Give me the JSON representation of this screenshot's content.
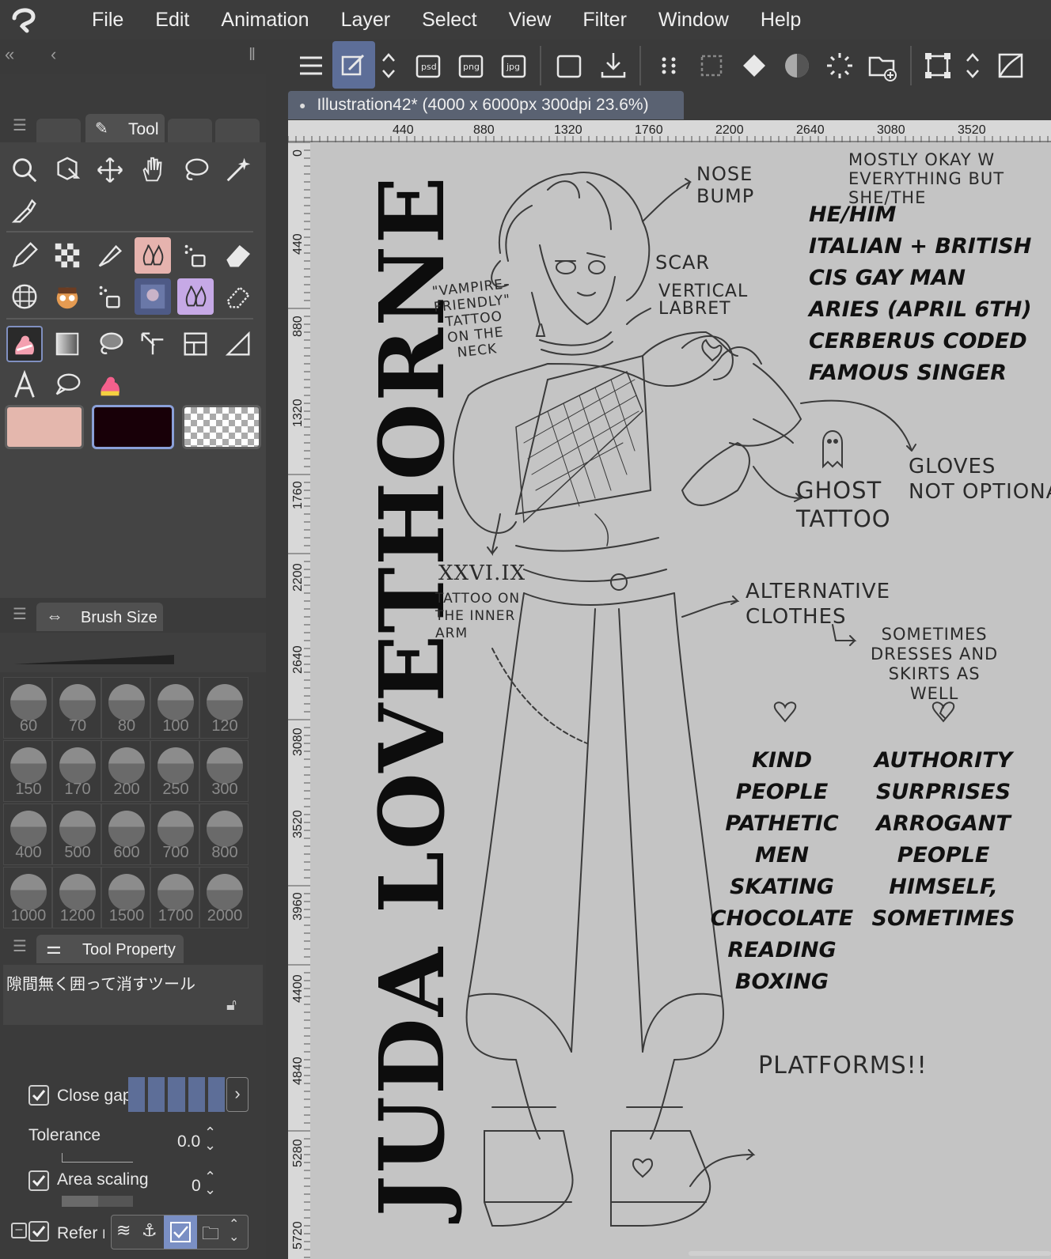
{
  "menubar": {
    "items": [
      "File",
      "Edit",
      "Animation",
      "Layer",
      "Select",
      "View",
      "Filter",
      "Window",
      "Help"
    ]
  },
  "tool_panel": {
    "tab_label": "Tool",
    "color_swatches": [
      "#e4b7ad",
      "#180008",
      "transparent"
    ]
  },
  "brush_size": {
    "title": "Brush Size",
    "sizes": [
      "60",
      "70",
      "80",
      "100",
      "120",
      "150",
      "170",
      "200",
      "250",
      "300",
      "400",
      "500",
      "600",
      "700",
      "800",
      "1000",
      "1200",
      "1500",
      "1700",
      "2000"
    ]
  },
  "tool_property": {
    "title": "Tool Property",
    "tool_name": "隙間無く囲って消すツール",
    "close_gap_label": "Close gap",
    "tolerance_label": "Tolerance",
    "tolerance_value": "0.0",
    "area_scaling_label": "Area scaling",
    "area_scaling_value": "0",
    "refer_label": "Refer m"
  },
  "document": {
    "tab_title": "Illustration42* (4000 x 6000px 300dpi 23.6%)",
    "ruler_top": [
      "440",
      "880",
      "1320",
      "1760",
      "2200",
      "2640",
      "3080",
      "3520"
    ],
    "ruler_left": [
      "0",
      "440",
      "880",
      "1320",
      "1760",
      "2200",
      "2640",
      "3080",
      "3520",
      "3960",
      "4400",
      "4840",
      "5280",
      "5720"
    ]
  },
  "artwork": {
    "vertical_title": "JUDA LOVETHORNE",
    "notes": {
      "nose": "NOSE\nBUMP",
      "scar": "SCAR",
      "labret": "VERTICAL\nLABRET",
      "vampire": "\"VAMPIRE-\nFRIENDLY\"\nTATTOO\nON THE\nNECK",
      "pronouns_note": "MOSTLY OKAY W\nEVERYTHING BUT\nSHE/THE",
      "ghost": "GHOST\nTATTOO",
      "gloves": "GLOVES\nNOT OPTIONAL",
      "roman": "XXVI.IX",
      "inner_arm": "TATTOO ON\nTHE INNER\nARM",
      "alt": "ALTERNATIVE\nCLOTHES",
      "sometimes": "SOMETIMES\nDRESSES AND\nSKIRTS AS\nWELL",
      "platforms": "PLATFORMS!!"
    },
    "facts": [
      "HE/HIM",
      "ITALIAN + BRITISH",
      "CIS GAY MAN",
      "ARIES (APRIL 6TH)",
      "CERBERUS CODED",
      "FAMOUS SINGER"
    ],
    "likes": [
      "KIND PEOPLE",
      "PATHETIC MEN",
      "SKATING",
      "CHOCOLATE",
      "READING",
      "BOXING"
    ],
    "dislikes": [
      "AUTHORITY",
      "SURPRISES",
      "ARROGANT",
      "PEOPLE",
      "HIMSELF,",
      "SOMETIMES"
    ]
  }
}
